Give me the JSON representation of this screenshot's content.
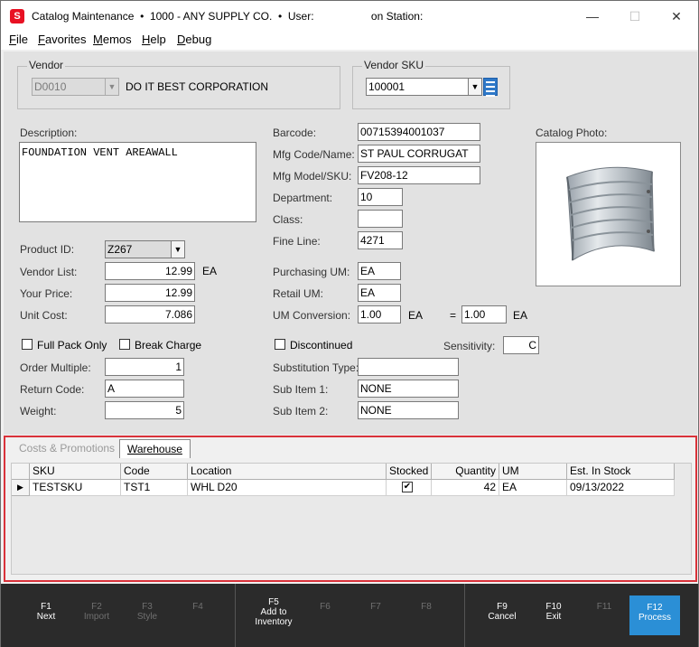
{
  "titlebar": {
    "app_icon": "S",
    "title": "Catalog Maintenance  •  1000 - ANY SUPPLY CO.  •  User:                   on Station:",
    "minimize": "—",
    "maximize": "☐",
    "close": "✕"
  },
  "menu": {
    "items": [
      {
        "label": "File",
        "underline": "F",
        "rest": "ile"
      },
      {
        "label": "Favorites",
        "underline": "F",
        "rest": "avorites"
      },
      {
        "label": "Memos",
        "underline": "M",
        "rest": "emos"
      },
      {
        "label": "Help",
        "underline": "H",
        "rest": "elp"
      },
      {
        "label": "Debug",
        "underline": "D",
        "rest": "ebug"
      }
    ]
  },
  "vendor": {
    "group_label": "Vendor",
    "code": "D0010",
    "name": "DO IT BEST CORPORATION"
  },
  "vendor_sku": {
    "group_label": "Vendor SKU",
    "value": "100001"
  },
  "description": {
    "label": "Description:",
    "value": "FOUNDATION VENT AREAWALL"
  },
  "left_fields": {
    "product_id_label": "Product ID:",
    "product_id": "Z267",
    "vendor_list_label": "Vendor List:",
    "vendor_list": "12.99",
    "vendor_list_unit": "EA",
    "your_price_label": "Your Price:",
    "your_price": "12.99",
    "unit_cost_label": "Unit Cost:",
    "unit_cost": "7.086",
    "full_pack_label": "Full Pack Only",
    "break_charge_label": "Break Charge",
    "order_multiple_label": "Order Multiple:",
    "order_multiple": "1",
    "return_code_label": "Return Code:",
    "return_code": "A",
    "weight_label": "Weight:",
    "weight": "5"
  },
  "mid_fields": {
    "barcode_label": "Barcode:",
    "barcode": "00715394001037",
    "mfg_code_label": "Mfg Code/Name:",
    "mfg_code": "ST PAUL CORRUGAT",
    "mfg_model_label": "Mfg Model/SKU:",
    "mfg_model": "FV208-12",
    "department_label": "Department:",
    "department": "10",
    "class_label": "Class:",
    "class": "",
    "fine_line_label": "Fine Line:",
    "fine_line": "4271",
    "purchasing_um_label": "Purchasing UM:",
    "purchasing_um": "EA",
    "retail_um_label": "Retail UM:",
    "retail_um": "EA",
    "um_conversion_label": "UM Conversion:",
    "um_conversion": "1.00",
    "um_conversion_unit": "EA",
    "equals": "=",
    "um_conversion_right": "1.00",
    "um_conversion_right_unit": "EA",
    "discontinued_label": "Discontinued",
    "substitution_type_label": "Substitution Type:",
    "substitution_type": "",
    "sub_item1_label": "Sub Item 1:",
    "sub_item1": "NONE",
    "sub_item2_label": "Sub Item 2:",
    "sub_item2": "NONE"
  },
  "right_fields": {
    "catalog_photo_label": "Catalog Photo:",
    "sensitivity_label": "Sensitivity:",
    "sensitivity": "C"
  },
  "tabs": [
    {
      "label": "Costs & Promotions",
      "active": false
    },
    {
      "label": "Warehouse",
      "active": true
    }
  ],
  "warehouse_grid": {
    "columns": [
      "SKU",
      "Code",
      "Location",
      "Stocked",
      "Quantity",
      "UM",
      "Est. In Stock"
    ],
    "rows": [
      {
        "sku": "TESTSKU",
        "code": "TST1",
        "location": "WHL D20",
        "stocked": true,
        "quantity": "42",
        "um": "EA",
        "est_in_stock": "09/13/2022"
      }
    ]
  },
  "fkeys": [
    {
      "key": "F1",
      "label": "Next",
      "enabled": true
    },
    {
      "key": "F2",
      "label": "Import",
      "enabled": false
    },
    {
      "key": "F3",
      "label": "Style",
      "enabled": false
    },
    {
      "key": "F4",
      "label": "",
      "enabled": false
    },
    {
      "key": "F5",
      "label": "Add to Inventory",
      "enabled": true
    },
    {
      "key": "F6",
      "label": "",
      "enabled": false
    },
    {
      "key": "F7",
      "label": "",
      "enabled": false
    },
    {
      "key": "F8",
      "label": "",
      "enabled": false
    },
    {
      "key": "F9",
      "label": "Cancel",
      "enabled": true
    },
    {
      "key": "F10",
      "label": "Exit",
      "enabled": true
    },
    {
      "key": "F11",
      "label": "",
      "enabled": false
    },
    {
      "key": "F12",
      "label": "Process",
      "enabled": true,
      "primary": true
    }
  ],
  "colors": {
    "accent": "#2b8fd6",
    "highlight_border": "#d9323a",
    "fkey_bar": "#2b2b2b",
    "app_icon": "#e81123"
  }
}
